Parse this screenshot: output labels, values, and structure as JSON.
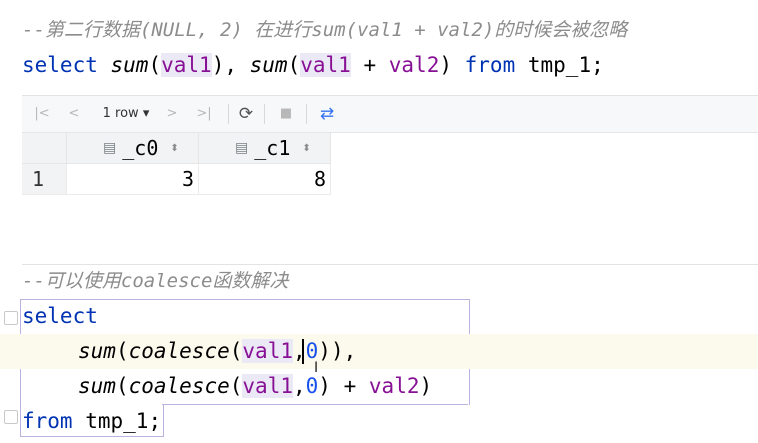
{
  "editor": {
    "line1_comment": "--第二行数据(NULL, 2) 在进行sum(val1 + val2)的时候会被忽略",
    "line2": {
      "kw_select": "select",
      "fn_sum1": "sum",
      "col_val1": "val1",
      "fn_sum2": "sum",
      "col_val1b": "val1",
      "plus": "+",
      "col_val2": "val2",
      "kw_from": "from",
      "table": "tmp_1",
      "semicolon": ";"
    },
    "line3_comment": "--可以使用coalesce函数解决",
    "line4": {
      "kw_select": "select"
    },
    "line5": {
      "fn_sum": "sum",
      "fn_coalesce": "coalesce",
      "col_val1": "val1",
      "num_zero": "0"
    },
    "line6": {
      "fn_sum": "sum",
      "fn_coalesce": "coalesce",
      "col_val1": "val1",
      "num_zero": "0",
      "plus": "+",
      "col_val2": "val2"
    },
    "line7": {
      "kw_from": "from",
      "table": "tmp_1",
      "semicolon": ";"
    }
  },
  "result_grid": {
    "toolbar": {
      "first_page_icon": "|<",
      "prev_page_icon": "<",
      "row_count": "1 row",
      "dropdown_icon": "▾",
      "next_page_icon": ">",
      "last_page_icon": ">|",
      "refresh_icon": "⟳",
      "stop_icon": "■",
      "compare_icon": "⇄"
    },
    "columns": [
      "_c0",
      "_c1"
    ],
    "rows": [
      {
        "num": "1",
        "values": [
          "3",
          "8"
        ]
      }
    ]
  }
}
